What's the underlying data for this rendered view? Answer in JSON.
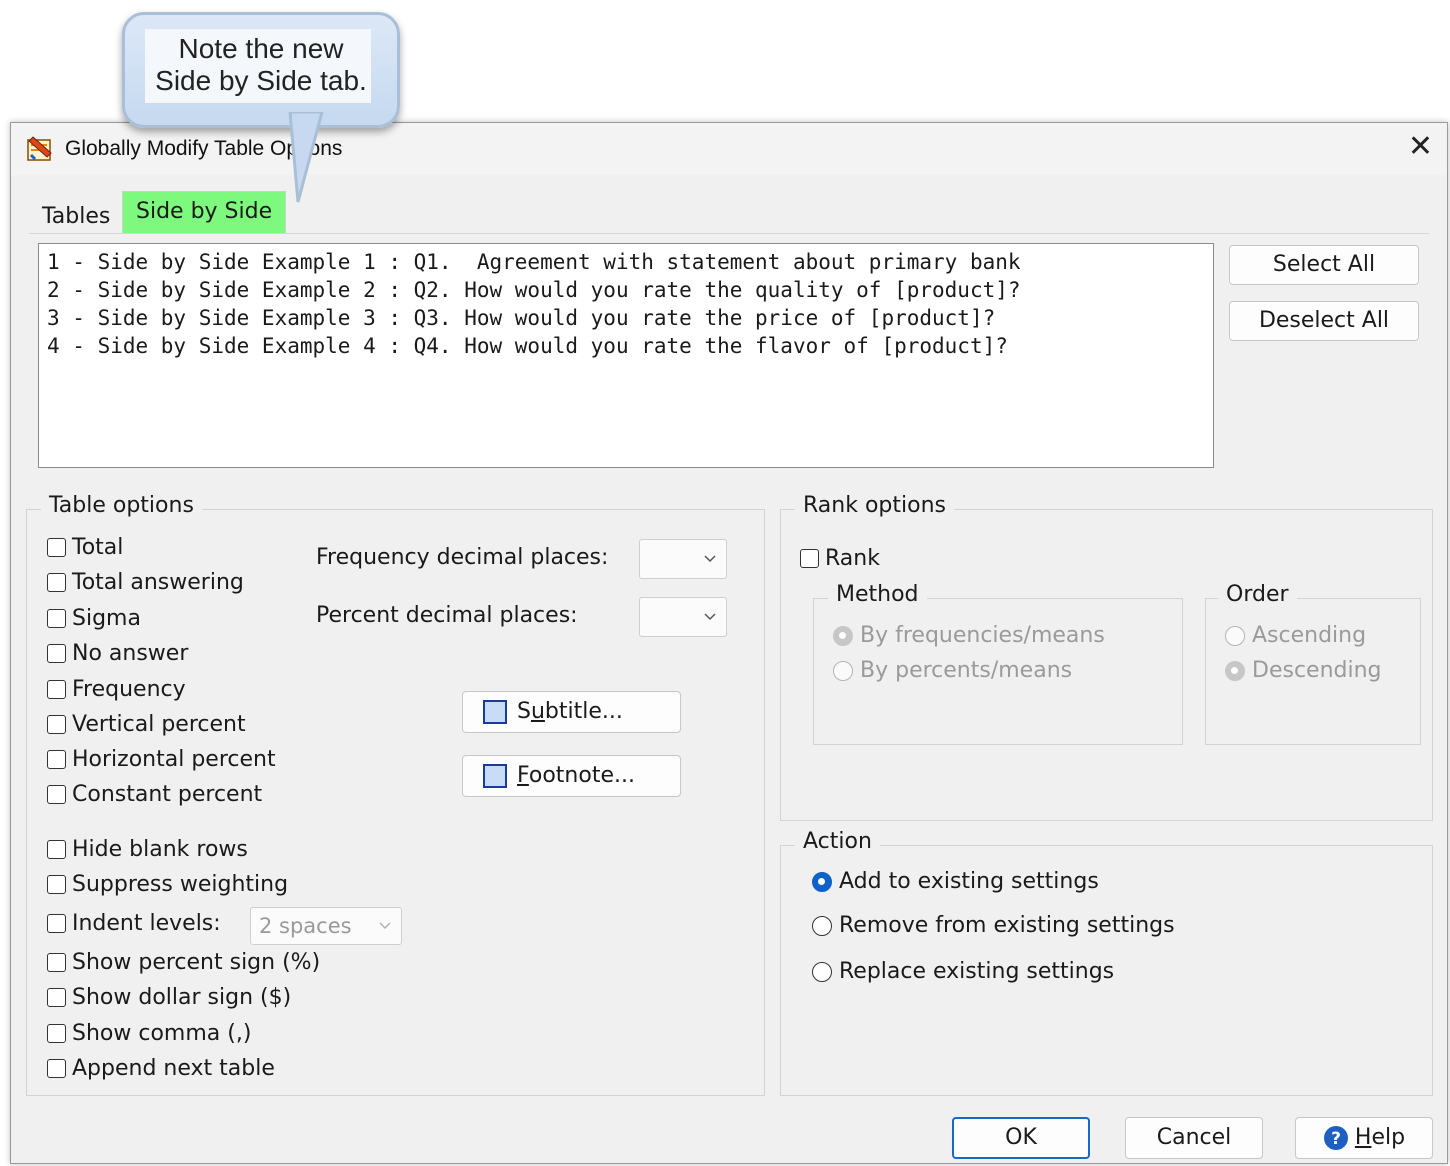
{
  "callout": {
    "line1": "Note the new",
    "line2": "Side by Side tab."
  },
  "dialog": {
    "title": "Globally Modify Table Options",
    "close_glyph": "✕",
    "tabs": [
      {
        "label": "Tables"
      },
      {
        "label": "Side by Side"
      }
    ],
    "table_list": [
      "1 - Side by Side Example 1 : Q1.  Agreement with statement about primary bank",
      "2 - Side by Side Example 2 : Q2. How would you rate the quality of [product]?",
      "3 - Side by Side Example 3 : Q3. How would you rate the price of [product]?",
      "4 - Side by Side Example 4 : Q4. How would you rate the flavor of [product]?"
    ],
    "select_all": "Select All",
    "deselect_all": "Deselect All"
  },
  "table_options": {
    "legend": "Table options",
    "checkboxes": [
      "Total",
      "Total answering",
      "Sigma",
      "No answer",
      "Frequency",
      "Vertical percent",
      "Horizontal percent",
      "Constant percent",
      "Hide blank rows",
      "Suppress weighting",
      "Indent levels:",
      "Show percent sign (%)",
      "Show dollar sign ($)",
      "Show comma (,)",
      "Append next table"
    ],
    "indent_value": "2 spaces",
    "freq_decimal_label": "Frequency decimal places:",
    "pct_decimal_label": "Percent decimal places:",
    "subtitle_pre": "S",
    "subtitle_ul": "u",
    "subtitle_post": "btitle...",
    "footnote_ul": "F",
    "footnote_post": "ootnote..."
  },
  "rank_options": {
    "legend": "Rank options",
    "rank_label": "Rank",
    "method_legend": "Method",
    "method_options": [
      "By frequencies/means",
      "By percents/means"
    ],
    "order_legend": "Order",
    "order_options": [
      "Ascending",
      "Descending"
    ]
  },
  "action": {
    "legend": "Action",
    "options": [
      "Add to existing settings",
      "Remove from existing settings",
      "Replace existing settings"
    ],
    "selected": 0
  },
  "footer": {
    "ok": "OK",
    "cancel": "Cancel",
    "help_ul": "H",
    "help_post": "elp"
  },
  "colors": {
    "active_tab": "#7dfa7d",
    "radio_selected": "#0e62c8"
  }
}
